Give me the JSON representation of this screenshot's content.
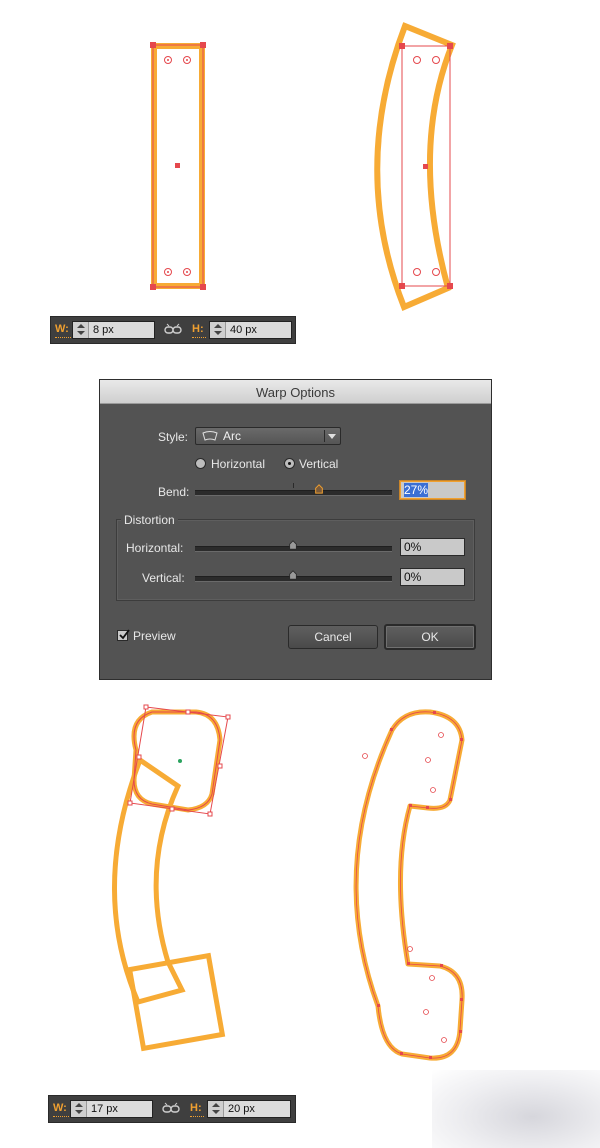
{
  "colors": {
    "stroke_orange": "#f7ab35",
    "anchor_red": "#e5484d",
    "dialog_bg": "#535353",
    "bend_highlight": "#f0a030"
  },
  "dimension_bar_top": {
    "width_label": "W:",
    "width_value": "8 px",
    "height_label": "H:",
    "height_value": "40 px",
    "link_icon": "chain-link-icon"
  },
  "warp_dialog": {
    "title": "Warp Options",
    "style_label": "Style:",
    "style_value": "Arc",
    "style_icon": "arc-warp-icon",
    "orientation": {
      "horizontal_label": "Horizontal",
      "vertical_label": "Vertical",
      "selected": "Vertical"
    },
    "bend": {
      "label": "Bend:",
      "value": "27%",
      "level_percent": 27
    },
    "distortion": {
      "group_title": "Distortion",
      "horizontal_label": "Horizontal:",
      "horizontal_value": "0%",
      "horizontal_level_percent": 0,
      "vertical_label": "Vertical:",
      "vertical_value": "0%",
      "vertical_level_percent": 0
    },
    "preview_label": "Preview",
    "preview_checked": true,
    "cancel_label": "Cancel",
    "ok_label": "OK"
  },
  "dimension_bar_bottom": {
    "width_label": "W:",
    "width_value": "17 px",
    "height_label": "H:",
    "height_value": "20 px",
    "link_icon": "chain-link-icon"
  }
}
